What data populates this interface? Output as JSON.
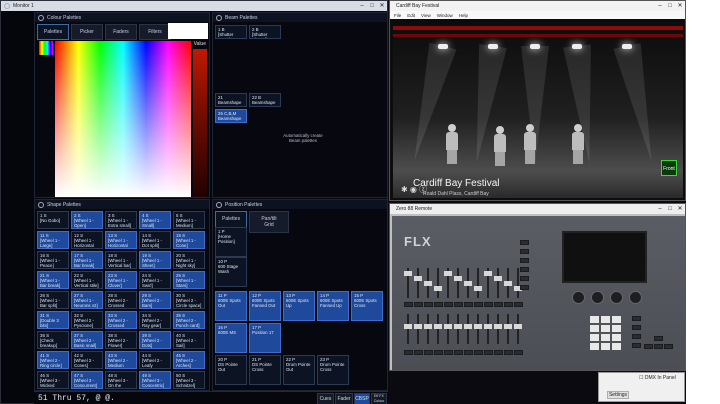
{
  "monitor": {
    "title": "Monitor 1",
    "colour_panel": {
      "title": "Colour Palettes",
      "tabs": [
        "Palettes",
        "Picker",
        "Faders",
        "Filters"
      ],
      "value_label": "Value"
    },
    "beam_panel": {
      "title": "Beam Palettes",
      "cells": [
        {
          "n": "1 B",
          "t": "[Shutter Open]"
        },
        {
          "n": "2 B",
          "t": "[Shutter Closed]"
        },
        {
          "n": "21",
          "t": "Beamshape 21"
        },
        {
          "n": "22 B",
          "t": "Beamshape 22"
        },
        {
          "n": "26 C,B,M",
          "t": "Beamshape 26"
        }
      ],
      "hint": "Automatically create Beam palettes"
    },
    "shape_panel": {
      "title": "Shape Palettes",
      "cells": [
        {
          "n": "1 S",
          "t": "[No Gobo]"
        },
        {
          "n": "2 S",
          "t": "[Wheel 1 - Open]"
        },
        {
          "n": "3 S",
          "t": "[Wheel 1 - Extra small]"
        },
        {
          "n": "4 S",
          "t": "[Wheel 1 - Small]"
        },
        {
          "n": "5 S",
          "t": "[Wheel 1 - Medium]"
        },
        {
          "n": "11 S",
          "t": "[Wheel 1 - Large]"
        },
        {
          "n": "12 S",
          "t": "[Wheel 1 - Horizontal bar]"
        },
        {
          "n": "13 S",
          "t": "[Wheel 1 - Horizontal bars]"
        },
        {
          "n": "14 S",
          "t": "[Wheel 1 - Dot split]"
        },
        {
          "n": "15 S",
          "t": "[Wheel 1 - Cone]"
        },
        {
          "n": "16 S",
          "t": "[Wheel 1 - Peace]"
        },
        {
          "n": "17 S",
          "t": "[Wheel 1 - Bar break]"
        },
        {
          "n": "18 S",
          "t": "[Wheel 1 - Vertical bar]"
        },
        {
          "n": "19 S",
          "t": "[Wheel 1 - Sheet]"
        },
        {
          "n": "20 S",
          "t": "[Wheel 1 - Night sky]"
        },
        {
          "n": "21 S",
          "t": "[Wheel 1 - Bar break]"
        },
        {
          "n": "22 S",
          "t": "[Wheel 1 - Vertical stile]"
        },
        {
          "n": "23 S",
          "t": "[Wheel 1 - Clover]"
        },
        {
          "n": "24 S",
          "t": "[Wheel 1 - Swirl]"
        },
        {
          "n": "25 S",
          "t": "[Wheel 1 - Stars]"
        },
        {
          "n": "26 S",
          "t": "[Wheel 1 - Bar split]"
        },
        {
          "n": "27 S",
          "t": "[Wheel 1 - Neurons v2]"
        },
        {
          "n": "28 S",
          "t": "[Wheel 2 - Crossed bars]"
        },
        {
          "n": "29 S",
          "t": "[Wheel 2 - Bars]"
        },
        {
          "n": "30 S",
          "t": "[Wheel 2 - Circle space]"
        },
        {
          "n": "31 S",
          "t": "[Double 3 bits]"
        },
        {
          "n": "32 S",
          "t": "[Wheel 2 - Pyscione]"
        },
        {
          "n": "33 S",
          "t": "[Wheel 2 - Crossed bars]"
        },
        {
          "n": "34 S",
          "t": "[Wheel 2 - Ray gear]"
        },
        {
          "n": "35 S",
          "t": "[Wheel 2 - Punch card]"
        },
        {
          "n": "36 S",
          "t": "[Check breakup]"
        },
        {
          "n": "37 S",
          "t": "[Wheel 2 - Basic snail]"
        },
        {
          "n": "38 S",
          "t": "[Wheel 2 - Flower]"
        },
        {
          "n": "39 S",
          "t": "[Wheel 2 - Dots]"
        },
        {
          "n": "40 S",
          "t": "[Wheel 2 - Sail]"
        },
        {
          "n": "41 S",
          "t": "[Wheel 2 - Ring circle]"
        },
        {
          "n": "42 S",
          "t": "[Wheel 2 - Cones]"
        },
        {
          "n": "43 S",
          "t": "[Wheel 2 - Medium circle]"
        },
        {
          "n": "44 S",
          "t": "[Wheel 2 - Leafy breakup]"
        },
        {
          "n": "45 S",
          "t": "[Wheel 2 - Arches]"
        },
        {
          "n": "46 S",
          "t": "[Wheel 3 - Wicked waves]"
        },
        {
          "n": "47 S",
          "t": "[Wheel 3 - Concurrent]"
        },
        {
          "n": "48 S",
          "t": "[Wheel 3 - On the rocks]"
        },
        {
          "n": "49 S",
          "t": "[Wheel 3 - Concentric]"
        },
        {
          "n": "50 S",
          "t": "[Wheel 3 - Schnitzel]"
        }
      ]
    },
    "position_panel": {
      "title": "Position Palettes",
      "tabs": [
        "Palettes",
        "Pan/tilt Grid"
      ],
      "cells": [
        {
          "n": "1 P",
          "t": "[Home Position]"
        },
        {
          "n": "10 P",
          "t": "600 Stage Wash"
        },
        {
          "n": "11 P",
          "t": "600E Spots Out"
        },
        {
          "n": "12 P",
          "t": "600E Spots Fanned Out"
        },
        {
          "n": "13 P",
          "t": "600E Spots Up"
        },
        {
          "n": "14 P",
          "t": "600E Spots Fanned Up"
        },
        {
          "n": "15 P",
          "t": "600E Spots Cross"
        },
        {
          "n": "16 P",
          "t": "600E MS"
        },
        {
          "n": "17 P",
          "t": "Position 17"
        },
        {
          "n": "20 P",
          "t": "DS Pointe Out"
        },
        {
          "n": "21 P",
          "t": "DS Pointe Cross"
        },
        {
          "n": "22 P",
          "t": "Drum Pointe Out"
        },
        {
          "n": "23 P",
          "t": "Drum Pointe Cross"
        }
      ]
    },
    "command_line": "51 Thru 57, @ @.",
    "cmd_buttons": [
      "Cues",
      "Fader",
      "CBSP",
      "Eff FX Colour"
    ]
  },
  "visualiser": {
    "title": "Cardiff Bay Festival",
    "menu": [
      "File",
      "Edit",
      "View",
      "Window",
      "Help"
    ],
    "caption": "Cardiff Bay Festival",
    "subcaption": "Roald Dahl Plass, Cardiff Bay",
    "view_label": "Front"
  },
  "remote": {
    "title": "Zero 88 Remote",
    "logo": "FLX"
  },
  "dialog": {
    "checkbox_label": "DMX In Panel",
    "button": "Settings"
  }
}
